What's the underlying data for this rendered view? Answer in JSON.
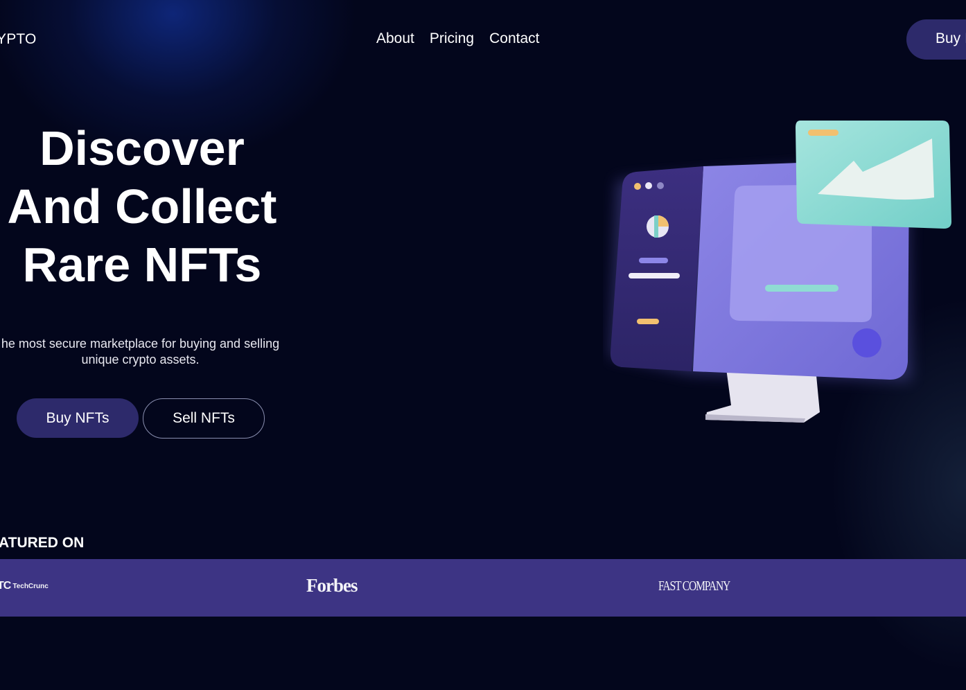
{
  "header": {
    "logo": "RYPTO",
    "nav": [
      {
        "label": "About"
      },
      {
        "label": "Pricing"
      },
      {
        "label": "Contact"
      }
    ],
    "cta_label": "Buy I"
  },
  "hero": {
    "title_lines": [
      "Discover",
      "And Collect",
      "Rare NFTs"
    ],
    "subtitle_lines": [
      "he most secure marketplace for buying and selling",
      "unique crypto assets."
    ],
    "buy_button": "Buy NFTs",
    "sell_button": "Sell NFTs",
    "illustration": "nft-monitor-illustration-icon"
  },
  "featured": {
    "label": "EATURED ON",
    "logos": [
      {
        "mark": "TC",
        "text": "TechCrunc"
      },
      {
        "text": "Forbes"
      },
      {
        "text": "FAST COMPANY"
      }
    ]
  },
  "colors": {
    "background": "#03061c",
    "accent": "#2d2a6b",
    "press_bar": "#3d3484",
    "monitor": "#7c76dc",
    "card": "#8fd8d2"
  }
}
